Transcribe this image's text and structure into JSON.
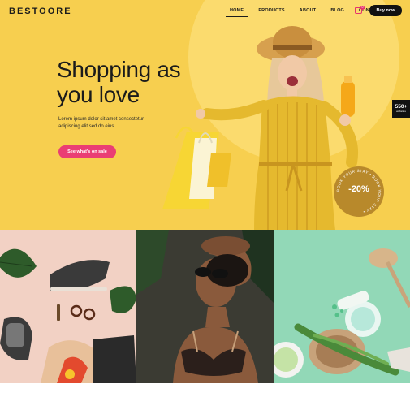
{
  "brand": {
    "logo_text": "BESTOORE"
  },
  "nav": {
    "items": [
      "HOME",
      "PRODUCTS",
      "ABOUT",
      "BLOG",
      "CONTACT"
    ],
    "active": "HOME"
  },
  "cart": {
    "count": "0",
    "icon": "cart-icon"
  },
  "header": {
    "buy_label": "Buy now"
  },
  "hero": {
    "headline_line1": "Shopping as",
    "headline_line2": "you love",
    "subtext": "Lorem ipsum dolor sit amet consectetur adipiscing elit sed do eius",
    "cta_label": "See what's on sale"
  },
  "side_badge": {
    "count": "550+",
    "label": "websites"
  },
  "discount": {
    "value": "-20%",
    "ring_text": "BOOK YOUR STAY • BOOK YOUR STAY •"
  },
  "colors": {
    "hero_bg": "#f7cf4f",
    "accent": "#ea3e74",
    "dark": "#111111",
    "badge_gold": "#b8892b",
    "tile_peach": "#f2d1c4",
    "tile_mint": "#92d8b7"
  },
  "tiles": [
    {
      "name": "fashion-accessories-photo",
      "icons": [
        "sneaker",
        "leaf",
        "sunglasses",
        "bag"
      ]
    },
    {
      "name": "woman-sunglasses-photo",
      "icons": [
        "sunglasses"
      ]
    },
    {
      "name": "cosmetics-aloe-photo",
      "icons": [
        "aloe",
        "bottle",
        "bowl"
      ]
    }
  ]
}
